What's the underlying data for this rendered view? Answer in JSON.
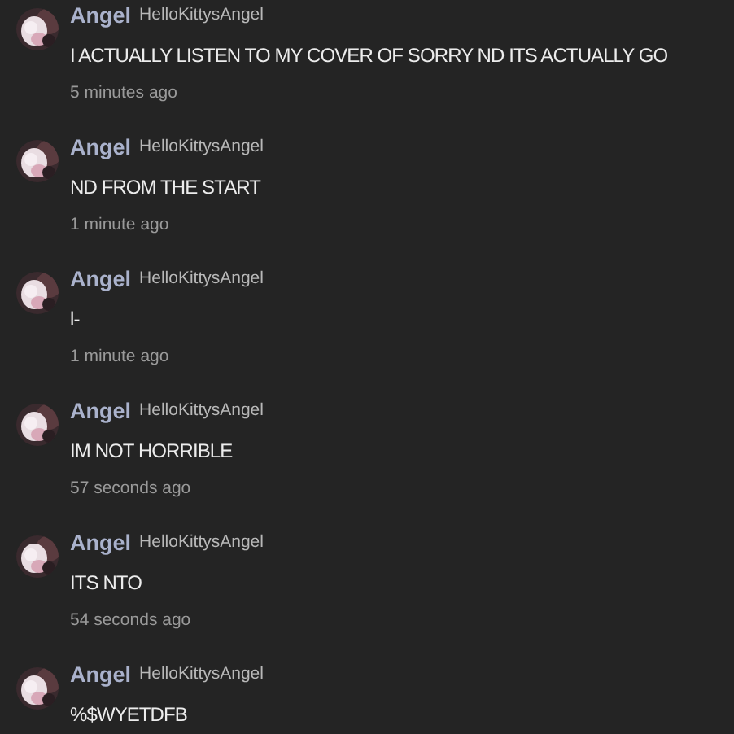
{
  "comments": [
    {
      "name": "Angel",
      "handle": "HelloKittysAngel",
      "text": "I ACTUALLY LISTEN TO MY COVER OF SORRY ND ITS ACTUALLY GO",
      "time": "5 minutes ago"
    },
    {
      "name": "Angel",
      "handle": "HelloKittysAngel",
      "text": "ND FROM THE START",
      "time": "1 minute ago"
    },
    {
      "name": "Angel",
      "handle": "HelloKittysAngel",
      "text": "l-",
      "time": "1 minute ago"
    },
    {
      "name": "Angel",
      "handle": "HelloKittysAngel",
      "text": "IM NOT HORRIBLE",
      "time": "57 seconds ago"
    },
    {
      "name": "Angel",
      "handle": "HelloKittysAngel",
      "text": "ITS NTO",
      "time": "54 seconds ago"
    },
    {
      "name": "Angel",
      "handle": "HelloKittysAngel",
      "text": "%$WYETDFB"
    }
  ]
}
